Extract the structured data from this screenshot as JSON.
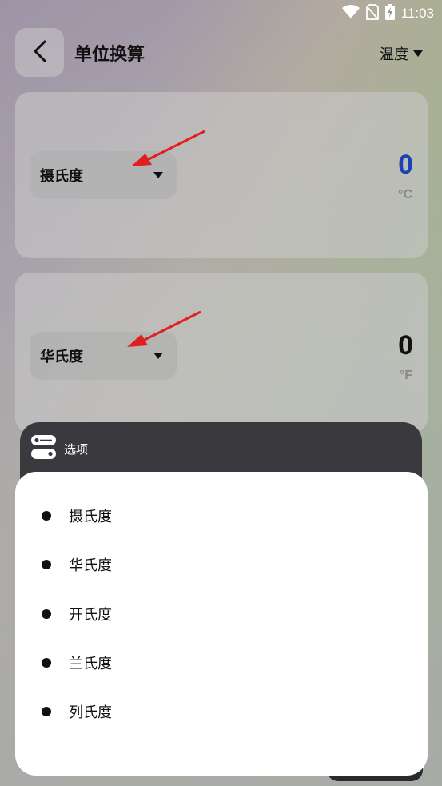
{
  "status_bar": {
    "time": "11:03",
    "icons": [
      "wifi-icon",
      "no-sim-icon",
      "battery-charging-icon"
    ]
  },
  "header": {
    "back_icon": "chevron-left-icon",
    "title": "单位换算",
    "category_select": "温度"
  },
  "converter": {
    "top": {
      "unit": "摄氏度",
      "value": "0",
      "symbol": "°C",
      "value_color": "#1d3fb8"
    },
    "bottom": {
      "unit": "华氏度",
      "value": "0",
      "symbol": "°F",
      "value_color": "#111111"
    }
  },
  "options_sheet": {
    "title": "选项",
    "title_icon": "options-toggle-icon",
    "items": [
      "摄氏度",
      "华氏度",
      "开氏度",
      "兰氏度",
      "列氏度"
    ]
  },
  "colors": {
    "annotation_arrow": "#e02020",
    "sheet_dark": "#3a393e"
  }
}
